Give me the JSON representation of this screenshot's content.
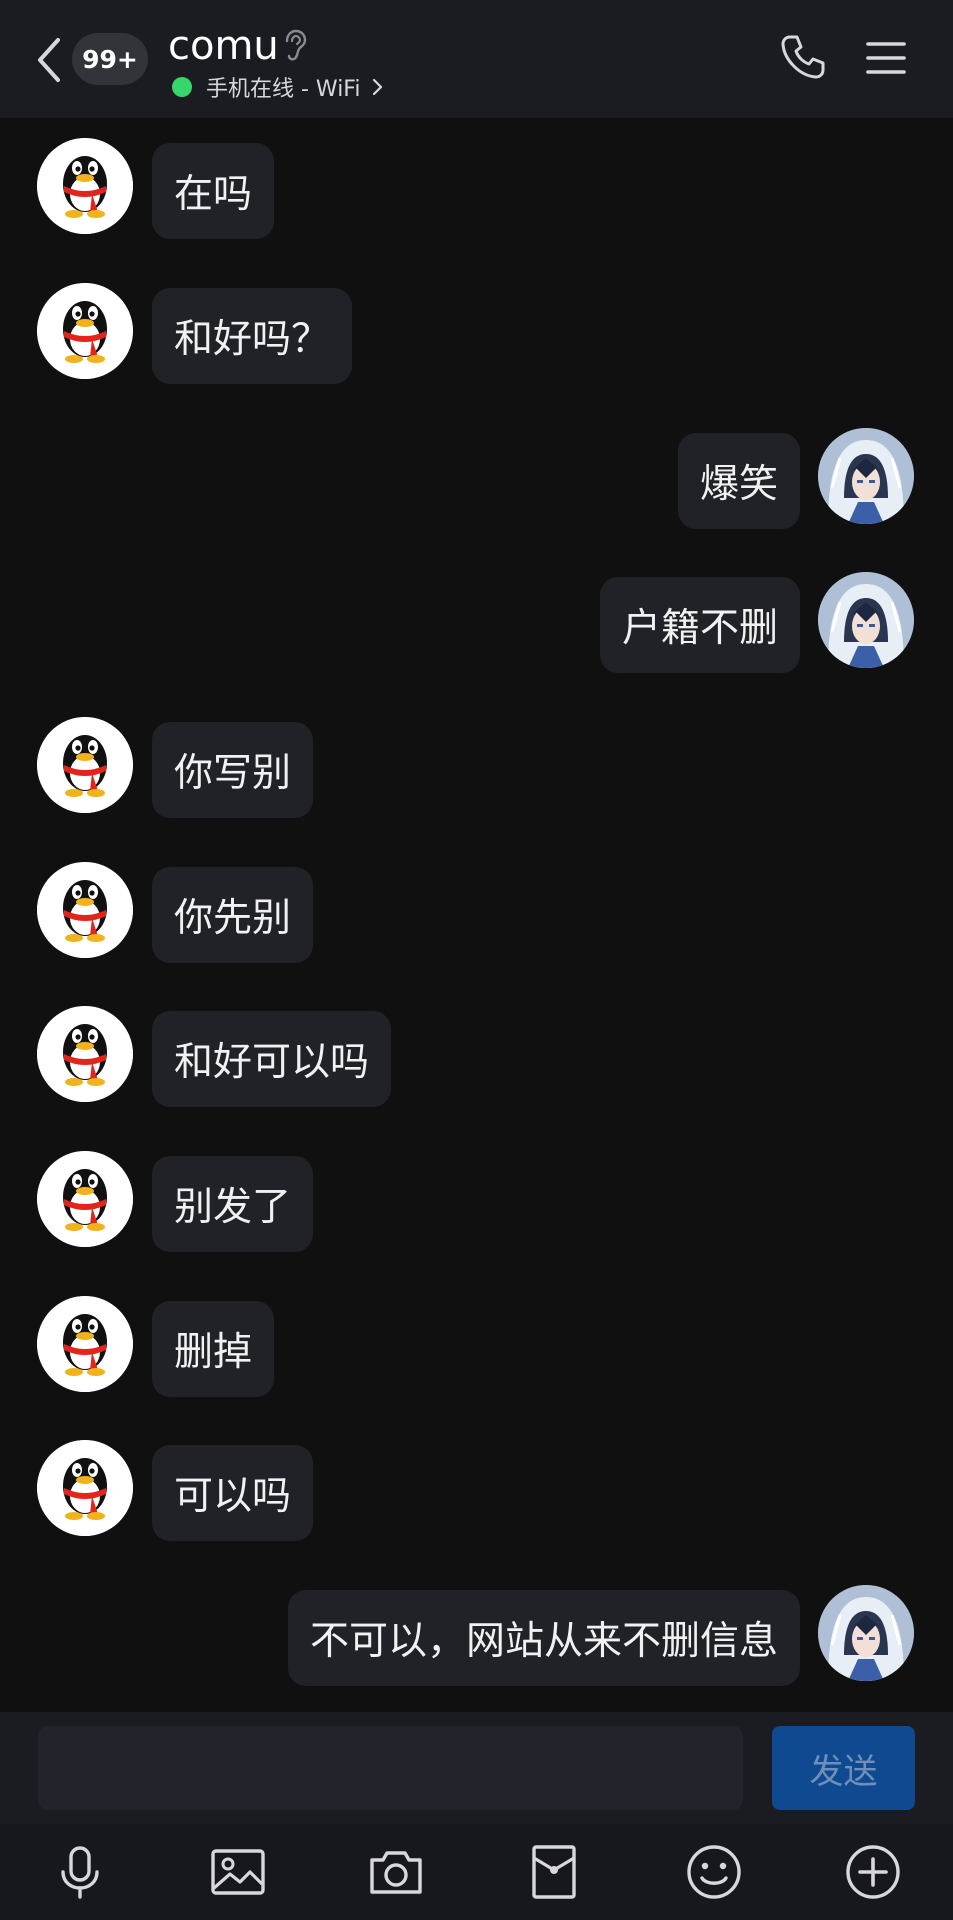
{
  "header": {
    "unread_badge": "99+",
    "contact_name": "comu",
    "status": "手机在线 - WiFi"
  },
  "messages": [
    {
      "side": "in",
      "text": "在吗"
    },
    {
      "side": "in",
      "text": "和好吗？"
    },
    {
      "side": "out",
      "text": "爆笑"
    },
    {
      "side": "out",
      "text": "户籍不删"
    },
    {
      "side": "in",
      "text": "你写别"
    },
    {
      "side": "in",
      "text": "你先别"
    },
    {
      "side": "in",
      "text": "和好可以吗"
    },
    {
      "side": "in",
      "text": "别发了"
    },
    {
      "side": "in",
      "text": "删掉"
    },
    {
      "side": "in",
      "text": "可以吗"
    },
    {
      "side": "out",
      "text": "不可以，网站从来不删信息"
    }
  ],
  "composer": {
    "input_value": "",
    "send_label": "发送"
  },
  "toolbar": {
    "icons": [
      "microphone-icon",
      "image-icon",
      "camera-icon",
      "red-packet-icon",
      "emoji-icon",
      "plus-icon"
    ]
  },
  "colors": {
    "background": "#101010",
    "header": "#1b1c22",
    "bubble": "#202227",
    "online": "#36d66b",
    "send_button": "#0f4a91"
  }
}
